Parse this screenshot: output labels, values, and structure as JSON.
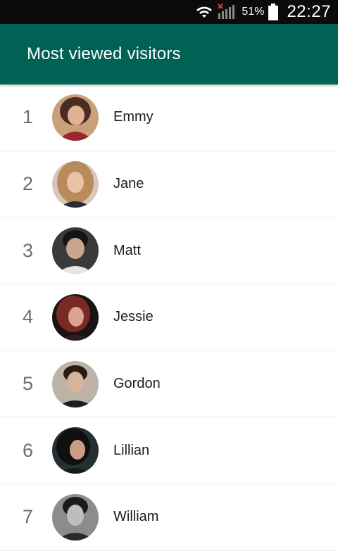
{
  "status_bar": {
    "wifi_icon": "wifi-icon",
    "signal_icon": "signal-no-service-icon",
    "battery_icon": "battery-icon",
    "battery_percent": "51%",
    "time": "22:27"
  },
  "app_bar": {
    "title": "Most viewed visitors",
    "color": "#006155"
  },
  "visitors": [
    {
      "rank": "1",
      "name": "Emmy"
    },
    {
      "rank": "2",
      "name": "Jane"
    },
    {
      "rank": "3",
      "name": "Matt"
    },
    {
      "rank": "4",
      "name": "Jessie"
    },
    {
      "rank": "5",
      "name": "Gordon"
    },
    {
      "rank": "6",
      "name": "Lillian"
    },
    {
      "rank": "7",
      "name": "William"
    }
  ]
}
